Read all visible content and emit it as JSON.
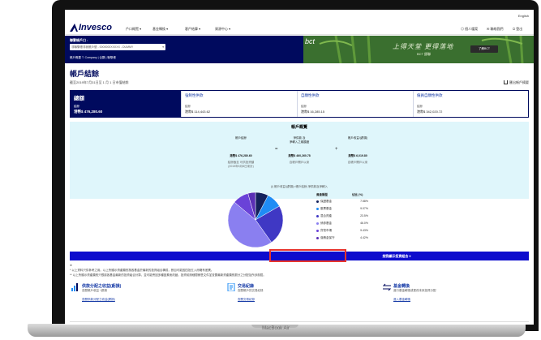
{
  "device": {
    "label": "MacBook Air"
  },
  "utility": {
    "language": "English"
  },
  "nav": {
    "brand": "Invesco",
    "items": [
      "戶口概覽 ▾",
      "基金轉換 ▾",
      "客戶結算 ▾",
      "資源中心 ▾"
    ],
    "right": [
      "個人檔案",
      "聯絡我們",
      "登出"
    ]
  },
  "hero": {
    "account_label": "聯繫帳戶口 :",
    "account_select": "非聯繫帳非我帳戶號 - 0000000XXXXX - DUMMY",
    "breadcrumb": "帳戶概要 T. Company | 合夥 | 聯繫帳",
    "banner_logo": "bct",
    "banner_callig": "上得天堂 更得落地",
    "banner_sub": "BCT 銀聯",
    "banner_button": "了解BCT"
  },
  "page": {
    "title": "帳戶結餘",
    "subtitle": "截至2019年7月31日至 1 月 1 日市值結餘",
    "export_label": "匯出帳戶摘要"
  },
  "summary": [
    {
      "title": "總額",
      "label": "結餘",
      "value": "港幣$ 476,280.60"
    },
    {
      "title": "強制性供款",
      "label": "結餘",
      "value": "港幣$ 114,443.62"
    },
    {
      "title": "自願性供款",
      "label": "結餘",
      "value": "港幣$ 16,285.15"
    },
    {
      "title": "僱員自願性供款",
      "label": "結餘",
      "value": "港幣$ 342,020.72"
    }
  ],
  "overview": {
    "title": "帳戶概覽",
    "columns": [
      {
        "head": "帳戶結餘",
        "value": "港幣$ 476,280.60",
        "sub": "結餘截至 可供投資額",
        "sub2": "(2019年5月8日來計)"
      },
      {
        "head": "淨供款 及\n淨轉入之總額度",
        "value": "港幣$ 460,260.78",
        "sub": "自帳戶開戶以來"
      },
      {
        "head": "帳戶收益/(虧損)",
        "value": "港幣$ 6,019.80",
        "sub": "自帳戶開戶以來"
      }
    ],
    "operators": [
      "=",
      "+"
    ],
    "note": "(i) 帳戶收益/(虧損)=帳戶結餘-淨供款及淨轉入"
  },
  "chart_data": {
    "type": "pie",
    "legend_header": [
      "資產類型",
      "佔比 (%)"
    ],
    "slices": [
      {
        "name": "保證基金",
        "value": 7.58,
        "color": "#14215c"
      },
      {
        "name": "股票基金",
        "value": 9.07,
        "color": "#1f8cf5"
      },
      {
        "name": "混合資產",
        "value": 23.5,
        "color": "#3f38c4"
      },
      {
        "name": "債券基金",
        "value": 46.0,
        "color": "#8a7ff0"
      },
      {
        "name": "貨幣市場",
        "value": 9.43,
        "color": "#6a42d8"
      },
      {
        "name": "強積金保守",
        "value": 4.42,
        "color": "#5a2fb5"
      }
    ],
    "legend_values": [
      "7.58%",
      "9.07%",
      "23.5%",
      "46.0%",
      "9.43%",
      "4.42%"
    ]
  },
  "holdings": {
    "button": "按我顯示投資組合 ▾"
  },
  "footnotes": [
    "※",
    "* 以上資料只供參考之用。以上所顯示資產類別按各基金於最新的投資組合構成，數目可能因四捨五入而略有差異。",
    "** 以上所顯示資產類別只根據各基金最新的投資組合計算，並可能會因多種因素而改變。投資前請細閱銷售文件並查閱最新資產類別劃分之分配及所涉風險。"
  ],
  "quick_links": [
    {
      "title": "供款分配之收益(虧損)",
      "sub": "查閱帳戶收益 / 虧損",
      "link": "查閱供款分配之收益(虧損)"
    },
    {
      "title": "交易紀錄",
      "sub": "查閱帳戶的交易紀錄",
      "link": "查閱交易紀錄"
    },
    {
      "title": "基金轉換",
      "sub": "進行基金轉換或更改未來投資分配",
      "link": "進入基金轉換"
    }
  ]
}
